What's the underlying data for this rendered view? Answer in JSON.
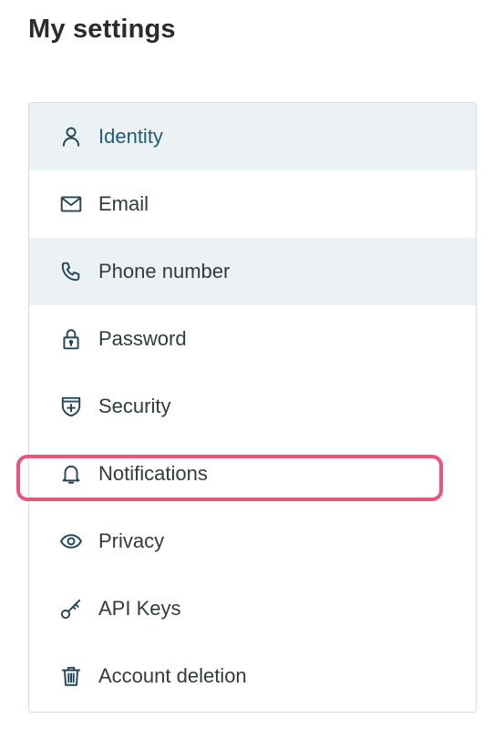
{
  "page": {
    "title": "My settings"
  },
  "menu": {
    "items": [
      {
        "id": "identity",
        "label": "Identity",
        "icon": "user-icon",
        "state": "active"
      },
      {
        "id": "email",
        "label": "Email",
        "icon": "envelope-icon",
        "state": "default"
      },
      {
        "id": "phone",
        "label": "Phone number",
        "icon": "phone-icon",
        "state": "hover"
      },
      {
        "id": "password",
        "label": "Password",
        "icon": "lock-icon",
        "state": "default"
      },
      {
        "id": "security",
        "label": "Security",
        "icon": "shield-plus-icon",
        "state": "default"
      },
      {
        "id": "notifications",
        "label": "Notifications",
        "icon": "bell-icon",
        "state": "highlighted"
      },
      {
        "id": "privacy",
        "label": "Privacy",
        "icon": "eye-icon",
        "state": "default"
      },
      {
        "id": "api-keys",
        "label": "API Keys",
        "icon": "key-icon",
        "state": "default"
      },
      {
        "id": "account-deletion",
        "label": "Account deletion",
        "icon": "trash-icon",
        "state": "default"
      }
    ]
  },
  "colors": {
    "active_text": "#1e5d79",
    "shaded_row": "#ecf1f3",
    "icon": "#24465a",
    "highlight": "#e6577c"
  }
}
